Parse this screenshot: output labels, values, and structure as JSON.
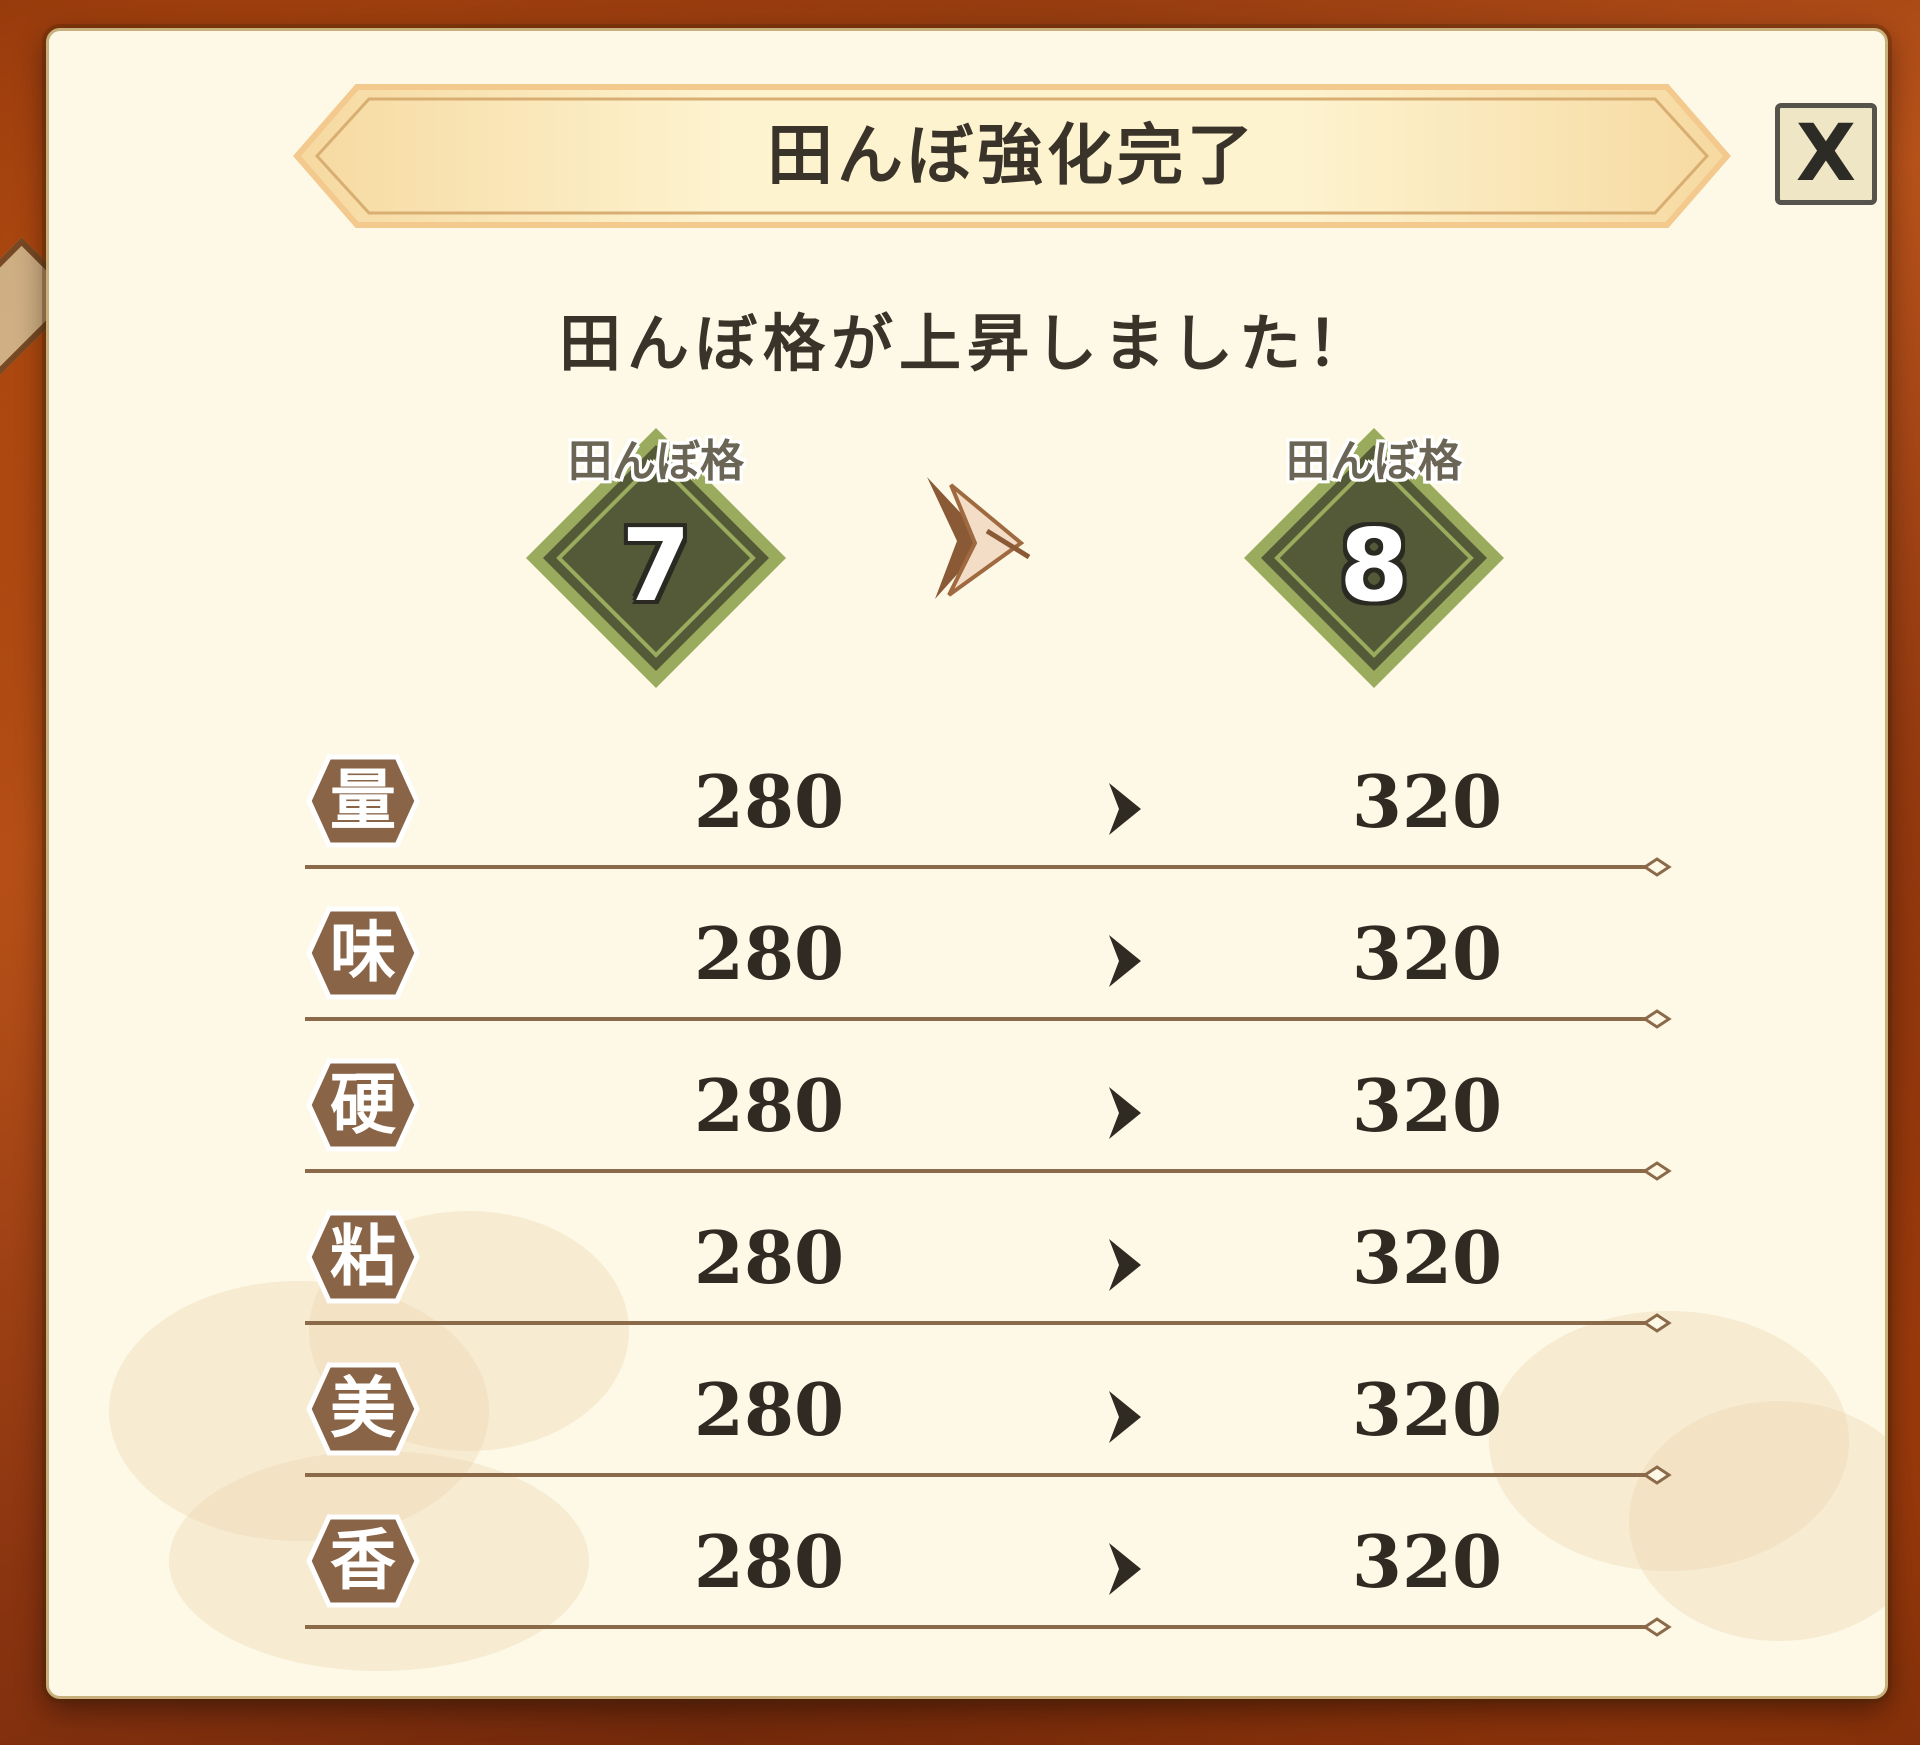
{
  "dialog": {
    "title": "田んぼ強化完了",
    "message": "田んぼ格が上昇しました！",
    "close_label": "X"
  },
  "rank": {
    "label": "田んぼ格",
    "before": "7",
    "after": "8"
  },
  "stats": [
    {
      "icon": "量",
      "before": "280",
      "after": "320"
    },
    {
      "icon": "味",
      "before": "280",
      "after": "320"
    },
    {
      "icon": "硬",
      "before": "280",
      "after": "320"
    },
    {
      "icon": "粘",
      "before": "280",
      "after": "320"
    },
    {
      "icon": "美",
      "before": "280",
      "after": "320"
    },
    {
      "icon": "香",
      "before": "280",
      "after": "320"
    }
  ],
  "colors": {
    "panel": "#fdf9e6",
    "banner": "#fbeab0",
    "badge_green": "#545a37",
    "badge_border": "#9aab5e",
    "stat_icon": "#8a6446",
    "divider": "#8b6a4a",
    "text": "#2f2a22"
  }
}
